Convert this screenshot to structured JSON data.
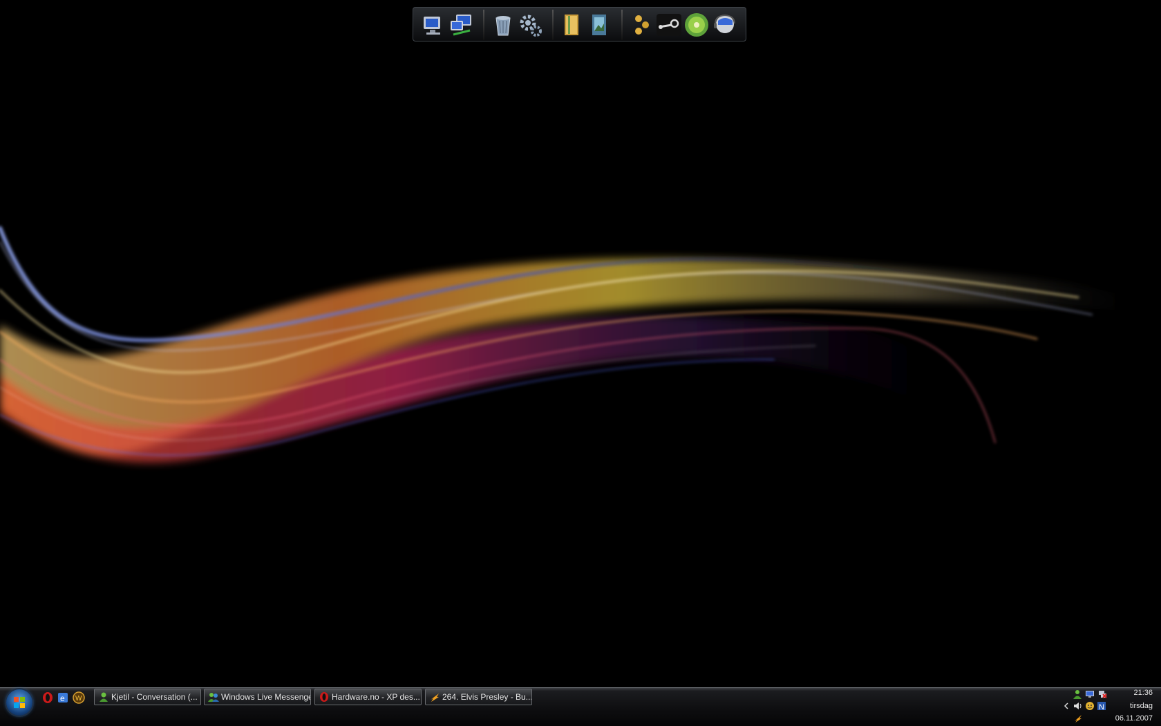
{
  "dock": {
    "icons": [
      "my-computer-icon",
      "network-places-icon",
      "recycle-bin-icon",
      "settings-gears-icon",
      "documents-folder-icon",
      "pictures-folder-icon",
      "network-share-icon",
      "steam-icon",
      "kiwi-app-icon",
      "messenger-icon"
    ]
  },
  "taskbar": {
    "quicklaunch": [
      "opera-icon",
      "ie-icon",
      "warcraft-icon"
    ],
    "tasks": [
      {
        "label": "Kjetil - Conversation (...",
        "icon": "messenger-user-icon"
      },
      {
        "label": "Windows Live Messenger",
        "icon": "messenger-users-icon"
      },
      {
        "label": "Hardware.no - XP des...",
        "icon": "opera-icon"
      },
      {
        "label": "264. Elvis Presley - Bu...",
        "icon": "winamp-icon"
      }
    ],
    "tray": {
      "time": "21:36",
      "day": "tirsdag",
      "date": "06.11.2007"
    }
  },
  "colors": {
    "accent": "#2b6bb0",
    "taskbar": "#0d0d0f"
  }
}
